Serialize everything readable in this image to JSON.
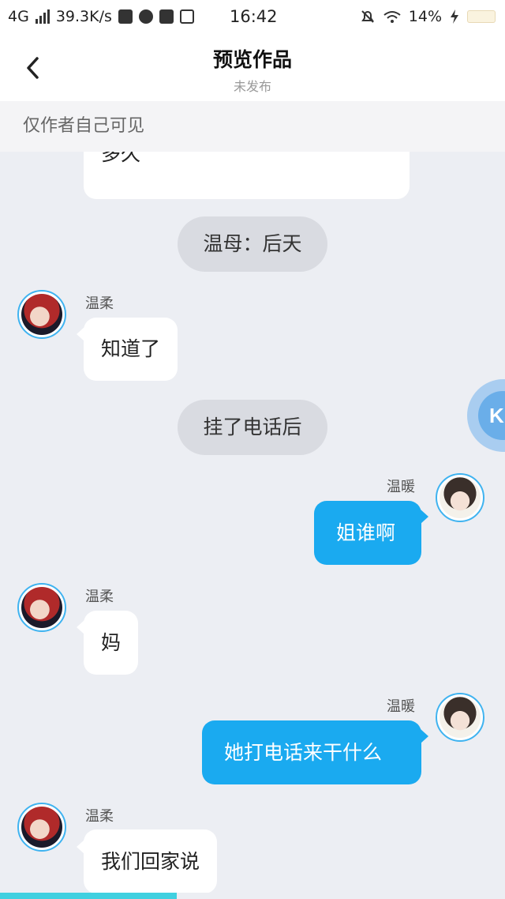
{
  "status_bar": {
    "network": "4G",
    "speed": "39.3K/s",
    "time": "16:42",
    "battery": "14%"
  },
  "header": {
    "back_icon": "chevron-left-icon",
    "title": "预览作品",
    "subtitle": "未发布"
  },
  "notice": "仅作者自己可见",
  "messages": [
    {
      "type": "left",
      "text": "多久"
    },
    {
      "type": "narration",
      "text": "温母：后天"
    },
    {
      "type": "left",
      "speaker": "温柔",
      "text": "知道了"
    },
    {
      "type": "narration",
      "text": "挂了电话后"
    },
    {
      "type": "right",
      "speaker": "温暖",
      "text": "姐谁啊"
    },
    {
      "type": "left",
      "speaker": "温柔",
      "text": "妈"
    },
    {
      "type": "right",
      "speaker": "温暖",
      "text": "她打电话来干什么"
    },
    {
      "type": "left",
      "speaker": "温柔",
      "text": "我们回家说"
    }
  ],
  "float_button": {
    "icon": "k-logo-icon",
    "label": "K"
  },
  "reading_progress": 0.35,
  "colors": {
    "right_bubble": "#1aaaf0",
    "background": "#eceef3",
    "avatar_ring": "#3fb3f0",
    "progress": "#40d0e0"
  }
}
